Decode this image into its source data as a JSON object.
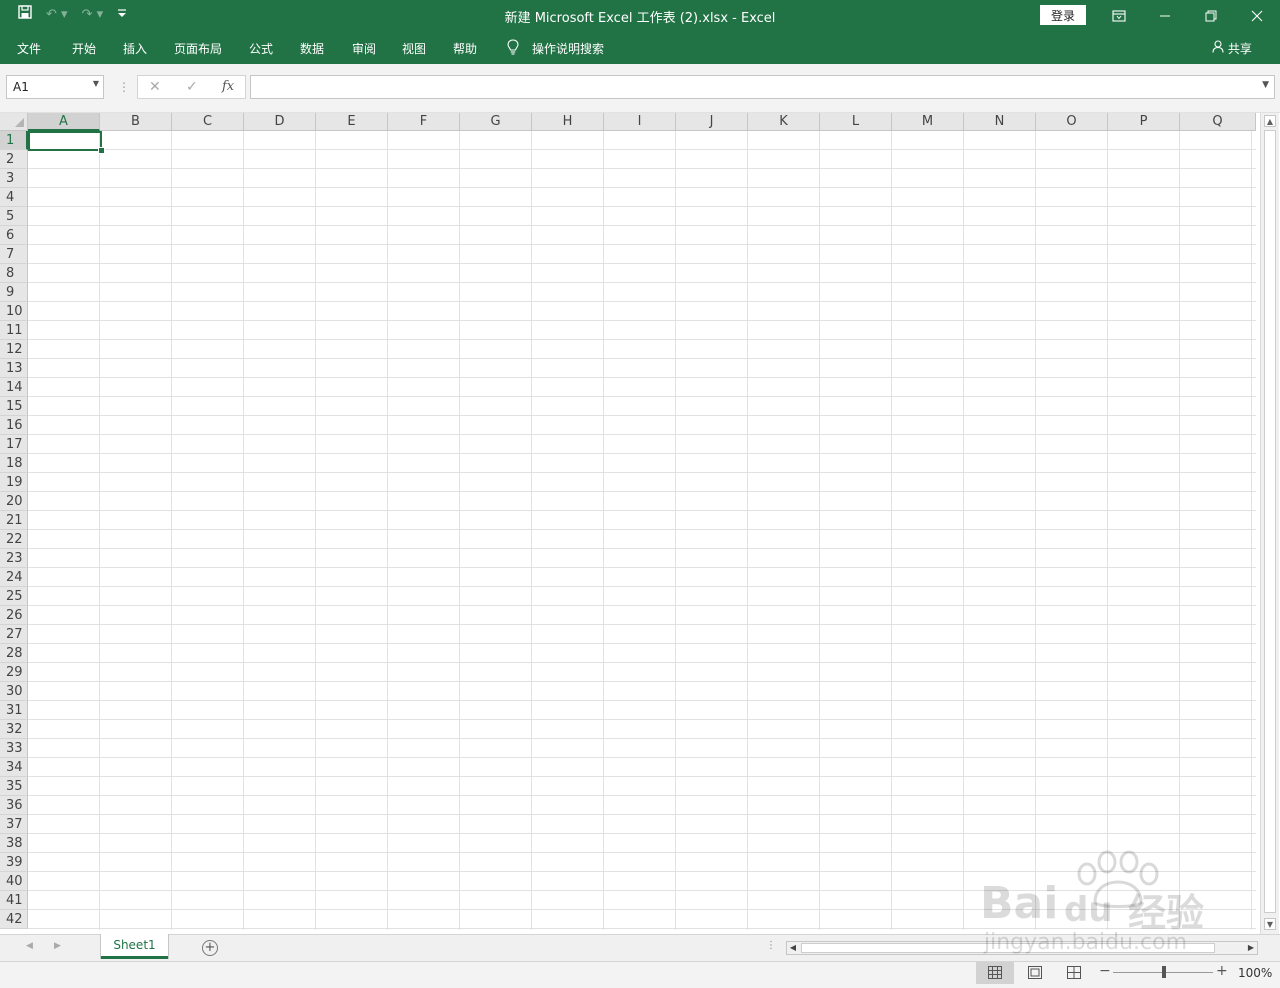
{
  "window": {
    "title": "新建 Microsoft Excel 工作表 (2).xlsx  -  Excel",
    "login_label": "登录"
  },
  "ribbon": {
    "tabs": [
      "文件",
      "开始",
      "插入",
      "页面布局",
      "公式",
      "数据",
      "审阅",
      "视图",
      "帮助"
    ],
    "tell_me": "操作说明搜索",
    "share": "共享"
  },
  "formula_bar": {
    "name_box": "A1",
    "cancel": "✕",
    "enter": "✓",
    "fx": "fx",
    "formula": ""
  },
  "grid": {
    "columns": [
      "A",
      "B",
      "C",
      "D",
      "E",
      "F",
      "G",
      "H",
      "I",
      "J",
      "K",
      "L",
      "M",
      "N",
      "O",
      "P",
      "Q"
    ],
    "rows": [
      "1",
      "2",
      "3",
      "4",
      "5",
      "6",
      "7",
      "8",
      "9",
      "10",
      "11",
      "12",
      "13",
      "14",
      "15",
      "16",
      "17",
      "18",
      "19",
      "20",
      "21",
      "22",
      "23",
      "24",
      "25",
      "26",
      "27",
      "28",
      "29",
      "30",
      "31",
      "32",
      "33",
      "34",
      "35",
      "36",
      "37",
      "38",
      "39",
      "40",
      "41",
      "42"
    ],
    "active_column": "A",
    "active_row": "1"
  },
  "sheets": {
    "tabs": [
      "Sheet1"
    ],
    "active": "Sheet1"
  },
  "status": {
    "zoom": "100%"
  },
  "watermark": {
    "line1": "Bai",
    "line2": "du",
    "line3": "经验",
    "url": "jingyan.baidu.com"
  },
  "icons": {
    "save": "save-icon",
    "undo": "undo-icon",
    "redo": "redo-icon",
    "customize": "customize-qat-icon",
    "ribbon_display": "ribbon-display-icon",
    "minimize": "minimize-icon",
    "restore": "restore-icon",
    "close": "close-icon",
    "lightbulb": "lightbulb-icon",
    "person": "person-icon"
  }
}
